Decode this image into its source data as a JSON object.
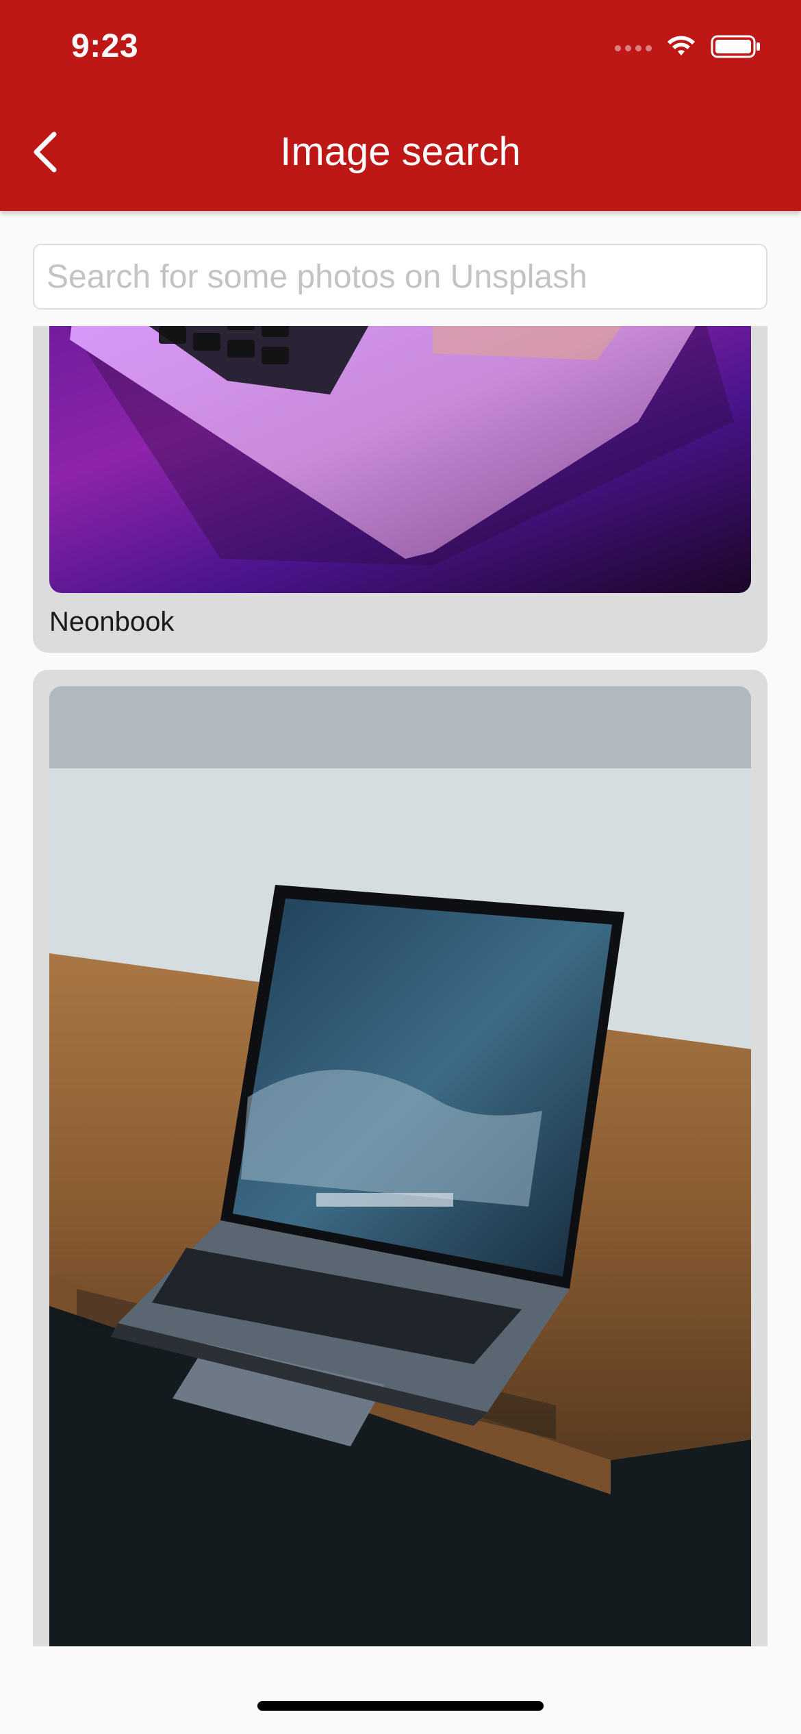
{
  "status_bar": {
    "time": "9:23"
  },
  "header": {
    "title": "Image search",
    "background": "#bd1716"
  },
  "search": {
    "value": "",
    "placeholder": "Search for some photos on Unsplash"
  },
  "results": [
    {
      "caption": "Neonbook"
    },
    {
      "caption": ""
    }
  ],
  "icons": {
    "back": "chevron-left-icon",
    "wifi": "wifi-icon",
    "battery": "battery-icon"
  }
}
